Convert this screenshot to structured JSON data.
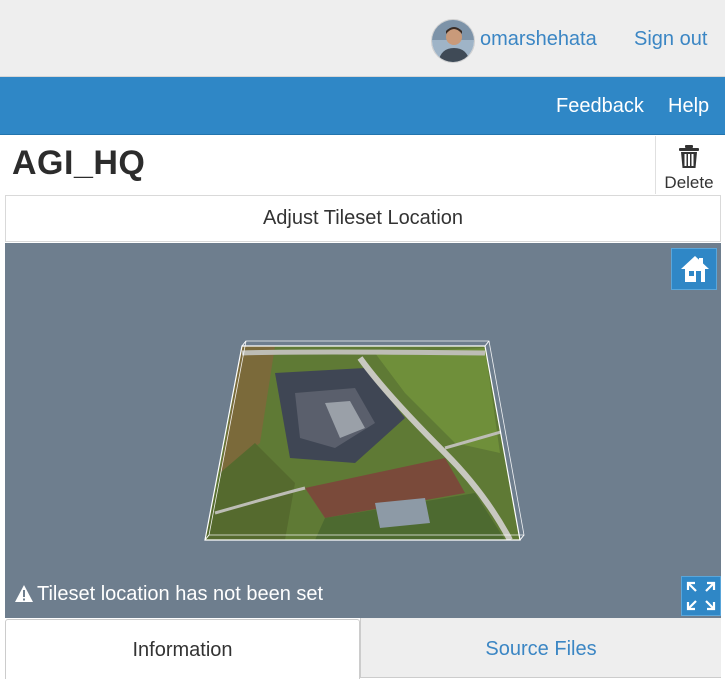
{
  "header": {
    "username": "omarshehata",
    "sign_out_label": "Sign out",
    "avatar_icon": "user-avatar"
  },
  "nav": {
    "feedback_label": "Feedback",
    "help_label": "Help"
  },
  "asset": {
    "title": "AGI_HQ",
    "delete_label": "Delete",
    "delete_icon": "trash-icon"
  },
  "adjust": {
    "label": "Adjust Tileset Location"
  },
  "viewer": {
    "warning_text": "Tileset location has not been set",
    "warning_icon": "warning-triangle-icon",
    "home_icon": "home-icon",
    "fullscreen_icon": "fullscreen-icon"
  },
  "tabs": [
    {
      "label": "Information",
      "active": true
    },
    {
      "label": "Source Files",
      "active": false
    }
  ],
  "colors": {
    "brand_blue": "#2f87c6",
    "link_blue": "#3b86c4",
    "viewer_bg": "#6e7e8e",
    "topbar_bg": "#eeeeee"
  }
}
